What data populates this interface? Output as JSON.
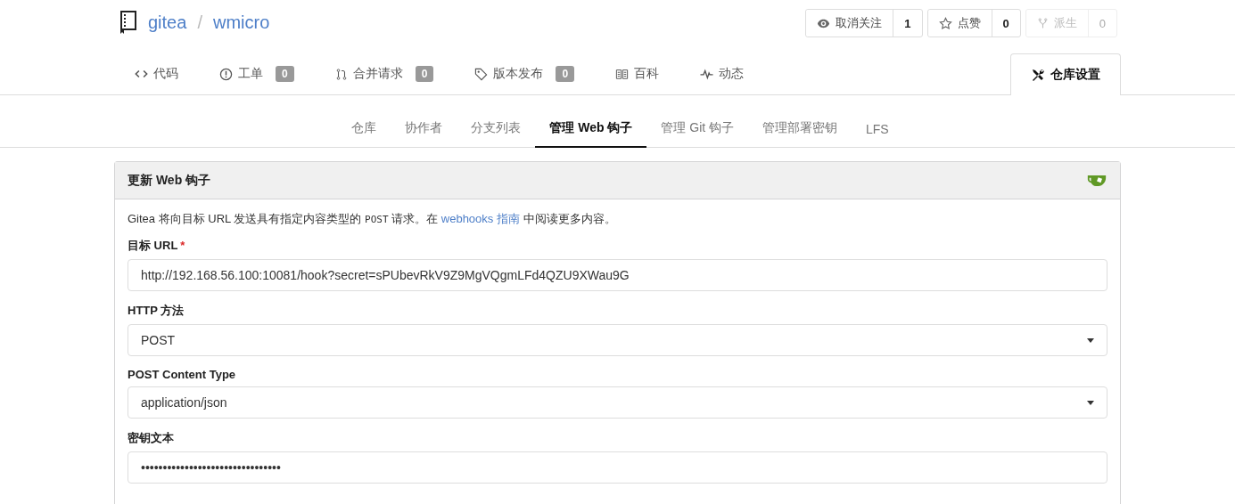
{
  "repo": {
    "owner": "gitea",
    "separator": "/",
    "name": "wmicro"
  },
  "actions": [
    {
      "kind": "watch",
      "label": "取消关注",
      "count": "1",
      "disabled": false
    },
    {
      "kind": "star",
      "label": "点赞",
      "count": "0",
      "disabled": false
    },
    {
      "kind": "fork",
      "label": "派生",
      "count": "0",
      "disabled": true
    }
  ],
  "tabs": [
    {
      "kind": "code",
      "label": "代码",
      "selected": false
    },
    {
      "kind": "issue",
      "label": "工单",
      "count": "0",
      "selected": false
    },
    {
      "kind": "pull",
      "label": "合并请求",
      "count": "0",
      "selected": false
    },
    {
      "kind": "tag",
      "label": "版本发布",
      "count": "0",
      "selected": false
    },
    {
      "kind": "wiki",
      "label": "百科",
      "selected": false
    },
    {
      "kind": "activity",
      "label": "动态",
      "selected": false
    },
    {
      "kind": "settings",
      "label": "仓库设置",
      "selected": true
    }
  ],
  "settings_menu": [
    {
      "label": "仓库",
      "selected": false
    },
    {
      "label": "协作者",
      "selected": false
    },
    {
      "label": "分支列表",
      "selected": false
    },
    {
      "label": "管理 Web 钩子",
      "selected": true
    },
    {
      "label": "管理 Git 钩子",
      "selected": false
    },
    {
      "label": "管理部署密钥",
      "selected": false
    },
    {
      "label": "LFS",
      "selected": false
    }
  ],
  "card": {
    "title": "更新 Web 钩子",
    "description": {
      "before": "Gitea 将向目标 URL 发送具有指定内容类型的",
      "code": "POST",
      "middle": "请求。在",
      "link": "webhooks 指南",
      "after": "中阅读更多内容。"
    },
    "fields": [
      {
        "kind": "text",
        "label": "目标 URL",
        "required_mark": "*",
        "value": "http://192.168.56.100:10081/hook?secret=sPUbevRkV9Z9MgVQgmLFd4QZU9XWau9G"
      },
      {
        "kind": "select",
        "label": "HTTP 方法",
        "value": "POST"
      },
      {
        "kind": "select",
        "label": "POST Content Type",
        "value": "application/json"
      },
      {
        "kind": "text",
        "label": "密钥文本",
        "value": "••••••••••••••••••••••••••••••••"
      }
    ]
  }
}
